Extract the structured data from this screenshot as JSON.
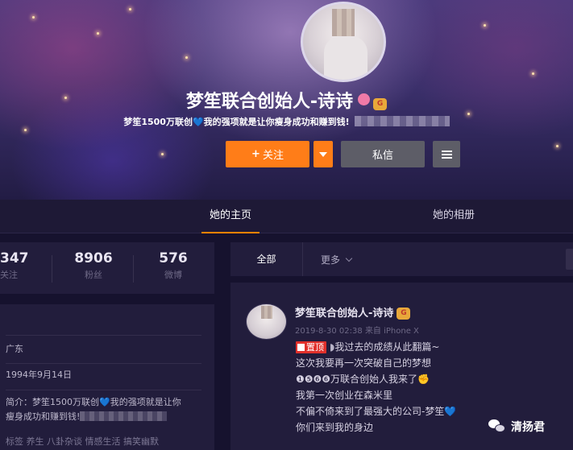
{
  "profile": {
    "name": "梦笙联合创始人-诗诗",
    "vip_badge": "G",
    "bio": "梦笙1500万联创",
    "bio_rest": "我的强项就是让你瘦身成功和赚到钱!",
    "heart": "💙",
    "follow_label": "关注",
    "follow_icon": "+",
    "message_label": "私信",
    "accent_color": "#ff7d18"
  },
  "tabs": [
    {
      "label": "她的主页",
      "active": true
    },
    {
      "label": "她的相册",
      "active": false
    }
  ],
  "stats": [
    {
      "value": "347",
      "label": "关注"
    },
    {
      "value": "8906",
      "label": "粉丝"
    },
    {
      "value": "576",
      "label": "微博"
    }
  ],
  "info": {
    "location": "广东",
    "birthday": "1994年9月14日",
    "intro_prefix": "简介：",
    "intro_text": "梦笙1500万联创",
    "intro_rest": "我的强项就是让你",
    "intro_line2": "瘦身成功和赚到钱!",
    "tags": "标签 养生 八卦杂谈 情感生活 搞笑幽默"
  },
  "filters": {
    "all_label": "全部",
    "more_label": "更多"
  },
  "post": {
    "author": "梦笙联合创始人-诗诗",
    "vip_badge": "G",
    "time": "2019-8-30 02:38",
    "source": "来自 iPhone X",
    "pin_label": "置顶",
    "lines": [
      "我过去的成绩从此翻篇~",
      "这次我要再一次突破自己的梦想",
      "❶❺❻❻万联合创始人我来了✊",
      "我第一次创业在森米里",
      "不偏不倚来到了最强大的公司-梦笙💙",
      "你们来到我的身边"
    ],
    "pin_icon_glyph": "◗"
  },
  "watermark": {
    "label": "清扬君",
    "icon": "wechat-icon"
  }
}
